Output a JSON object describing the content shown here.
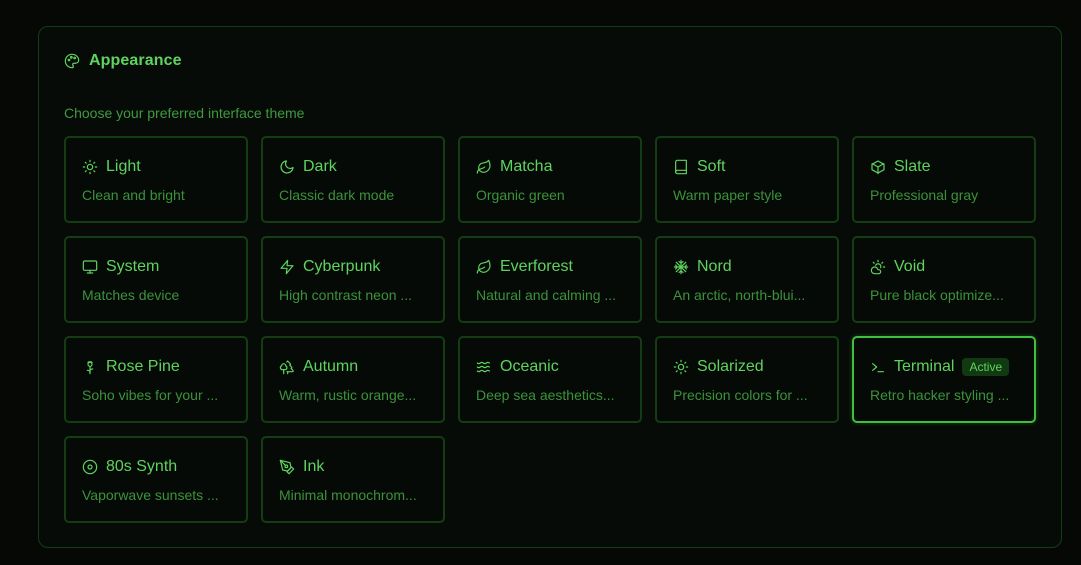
{
  "appearance": {
    "title": "Appearance",
    "subtitle": "Choose your preferred interface theme",
    "active_badge": "Active"
  },
  "themes": [
    {
      "name": "Light",
      "desc": "Clean and bright",
      "icon": "sun-icon"
    },
    {
      "name": "Dark",
      "desc": "Classic dark mode",
      "icon": "moon-icon"
    },
    {
      "name": "Matcha",
      "desc": "Organic green",
      "icon": "leaf-icon"
    },
    {
      "name": "Soft",
      "desc": "Warm paper style",
      "icon": "book-icon"
    },
    {
      "name": "Slate",
      "desc": "Professional gray",
      "icon": "cube-icon"
    },
    {
      "name": "System",
      "desc": "Matches device",
      "icon": "monitor-icon"
    },
    {
      "name": "Cyberpunk",
      "desc": "High contrast neon ...",
      "icon": "zap-icon"
    },
    {
      "name": "Everforest",
      "desc": "Natural and calming ...",
      "icon": "leaf-icon"
    },
    {
      "name": "Nord",
      "desc": "An arctic, north-blui...",
      "icon": "snowflake-icon"
    },
    {
      "name": "Void",
      "desc": "Pure black optimize...",
      "icon": "cloud-sun-icon"
    },
    {
      "name": "Rose Pine",
      "desc": "Soho vibes for your ...",
      "icon": "flower-icon"
    },
    {
      "name": "Autumn",
      "desc": "Warm, rustic orange...",
      "icon": "tree-icon"
    },
    {
      "name": "Oceanic",
      "desc": "Deep sea aesthetics...",
      "icon": "waves-icon"
    },
    {
      "name": "Solarized",
      "desc": "Precision colors for ...",
      "icon": "sun-icon"
    },
    {
      "name": "Terminal",
      "desc": "Retro hacker styling ...",
      "icon": "terminal-icon",
      "active": true
    },
    {
      "name": "80s Synth",
      "desc": "Vaporwave sunsets ...",
      "icon": "disc-icon"
    },
    {
      "name": "Ink",
      "desc": "Minimal monochrom...",
      "icon": "pen-icon"
    }
  ],
  "colors": {
    "accent": "#5fd35f",
    "border": "#143d14",
    "active_border": "#3fbf3f",
    "background": "#050805"
  }
}
